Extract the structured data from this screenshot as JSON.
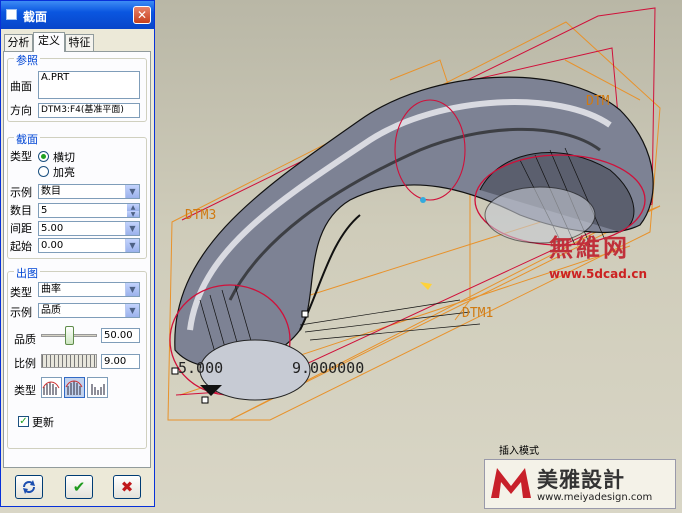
{
  "window": {
    "title": "截面",
    "close_glyph": "✕"
  },
  "tabs": [
    {
      "label": "分析",
      "active": false
    },
    {
      "label": "定义",
      "active": true
    },
    {
      "label": "特征",
      "active": false
    }
  ],
  "reference": {
    "group_title": "参照",
    "surface_label": "曲面",
    "surface_value": "A.PRT",
    "direction_label": "方向",
    "direction_value": "DTM3:F4(基准平面)"
  },
  "section": {
    "group_title": "截面",
    "type_label": "类型",
    "type_options": [
      {
        "label": "横切",
        "selected": true
      },
      {
        "label": "加亮",
        "selected": false
      }
    ],
    "example_label": "示例",
    "example_value": "数目",
    "count_label": "数目",
    "count_value": "5",
    "spacing_label": "间距",
    "spacing_value": "5.00",
    "start_label": "起始",
    "start_value": "0.00"
  },
  "plot": {
    "group_title": "出图",
    "type_label": "类型",
    "type_value": "曲率",
    "example_label": "示例",
    "example_value": "品质",
    "quality_label": "品质",
    "quality_value": "50.00",
    "quality_level": 0.5,
    "scale_label": "比例",
    "scale_value": "9.00",
    "plot_type_label": "类型",
    "plot_type_icons": [
      "curvature-left-icon",
      "curvature-both-icon",
      "curvature-right-icon"
    ],
    "update_label": "更新",
    "update_checked": true
  },
  "footer_buttons": {
    "repaint_icon": "repaint-icon",
    "ok_glyph": "✔",
    "cancel_glyph": "✖"
  },
  "viewport": {
    "datum_labels": [
      "DTM3",
      "DTM1",
      "DTM"
    ],
    "dim_left": "5.000",
    "dim_right": "9.000000",
    "mode_text": "插入模式",
    "accent_orange": "#e8922b",
    "accent_red": "#d0103a"
  },
  "watermark1": {
    "title": "無維网",
    "url": "www.5dcad.cn"
  },
  "watermark2": {
    "title": "美雅設計",
    "url": "www.meiyadesign.com"
  }
}
